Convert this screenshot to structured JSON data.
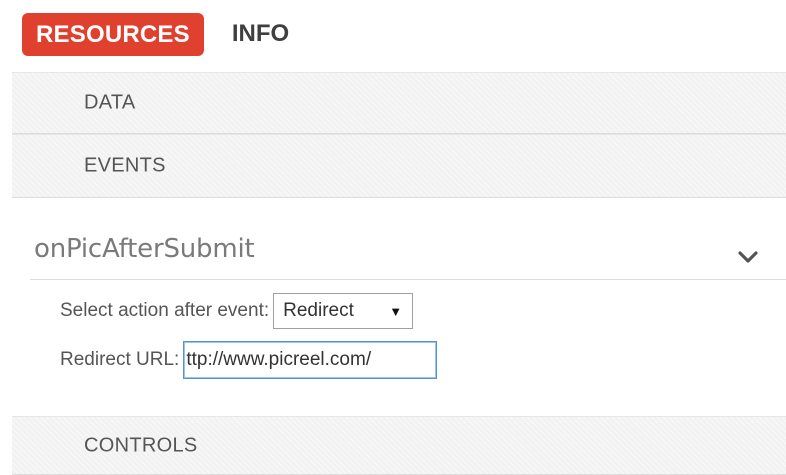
{
  "tabs": {
    "resources": "RESOURCES",
    "info": "INFO"
  },
  "sections": {
    "data": "DATA",
    "events": "EVENTS",
    "controls": "CONTROLS"
  },
  "event": {
    "name": "onPicAfterSubmit",
    "action_label": "Select action after event:",
    "action_value": "Redirect",
    "url_label": "Redirect URL:",
    "url_value": "ttp://www.picreel.com/"
  },
  "colors": {
    "accent": "#e0402e",
    "focus_border": "#5a90d8"
  },
  "icons": {
    "expand": "chevron-down-icon",
    "select": "triangle-down-icon"
  }
}
